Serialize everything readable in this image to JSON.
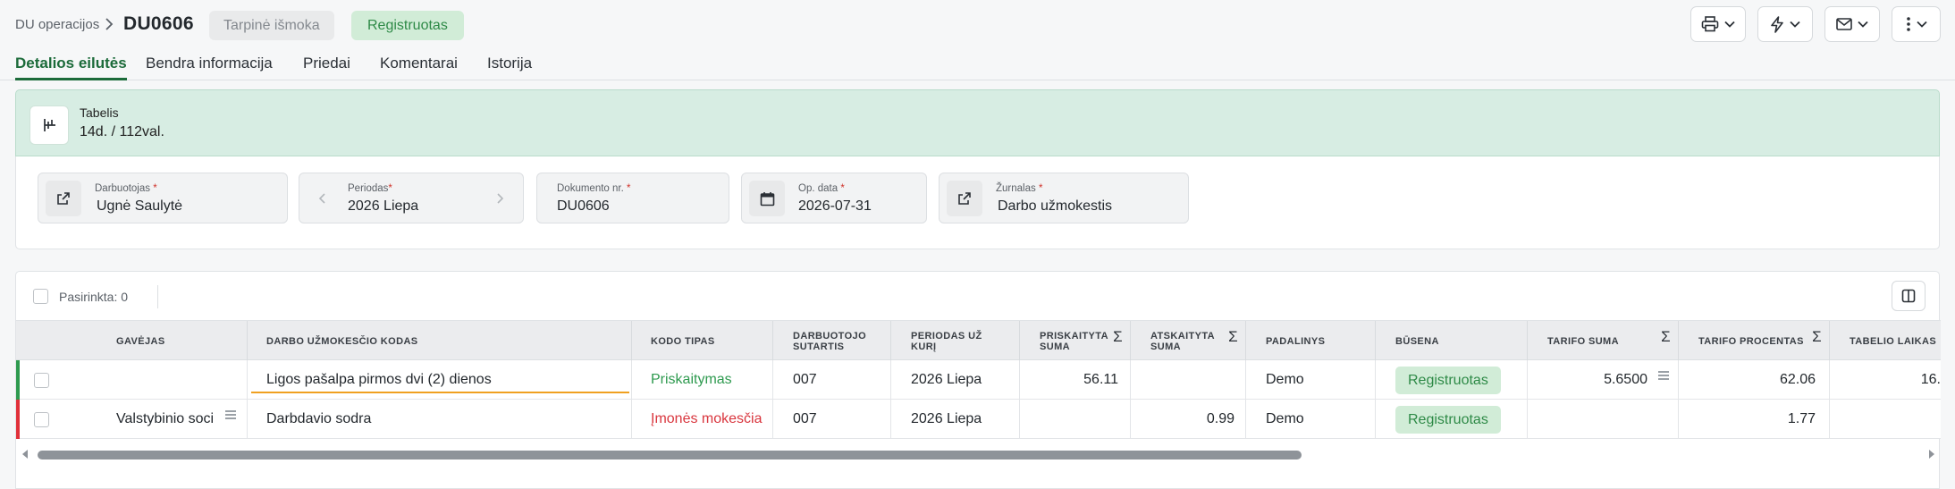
{
  "header": {
    "breadcrumb": "DU operacijos",
    "doc_number": "DU0606",
    "badge_type": "Tarpinė išmoka",
    "badge_status": "Registruotas"
  },
  "toolbar_buttons": [
    {
      "icon": "printer-icon"
    },
    {
      "icon": "lightning-icon"
    },
    {
      "icon": "mail-icon"
    },
    {
      "icon": "more-vertical-icon"
    }
  ],
  "tabs": [
    {
      "label": "Detalios eilutės",
      "active": true
    },
    {
      "label": "Bendra informacija",
      "active": false
    },
    {
      "label": "Priedai",
      "active": false
    },
    {
      "label": "Komentarai",
      "active": false
    },
    {
      "label": "Istorija",
      "active": false
    }
  ],
  "banner": {
    "label": "Tabelis",
    "value": "14d. / 112val."
  },
  "fields": {
    "employee": {
      "label": "Darbuotojas",
      "required": "*",
      "value": "Ugnė Saulytė"
    },
    "period": {
      "label": "Periodas",
      "required": "*",
      "value": "2026 Liepa"
    },
    "doc_nr": {
      "label": "Dokumento nr.",
      "required": "*",
      "value": "DU0606"
    },
    "op_date": {
      "label": "Op. data",
      "required": "*",
      "value": "2026-07-31"
    },
    "journal": {
      "label": "Žurnalas",
      "required": "*",
      "value": "Darbo užmokestis"
    }
  },
  "table": {
    "selected_text": "Pasirinkta: 0",
    "columns": [
      "Gavėjas",
      "Darbo užmokesčio kodas",
      "Kodo tipas",
      "Darbuotojo sutartis",
      "Periodas už kurį",
      "Priskaityta suma",
      "Atskaityta suma",
      "Padalinys",
      "Būsena",
      "Tarifo suma",
      "Tarifo procentas",
      "Tabelio laikas"
    ],
    "sum_symbol": "Σ",
    "rows": [
      {
        "marker": "#2e9a4f",
        "recipient": "",
        "code": "Ligos pašalpa pirmos dvi (2) dienos",
        "code_type": "Priskaitymas",
        "code_type_color": "#2e9a4f",
        "contract": "007",
        "period": "2026 Liepa",
        "accrued": "56.11",
        "deducted": "",
        "unit": "Demo",
        "status": "Registruotas",
        "rate_sum": "5.6500",
        "rate_pct": "62.06",
        "time": "16."
      },
      {
        "marker": "#e0303a",
        "recipient": "Valstybinio soci",
        "code": "Darbdavio sodra",
        "code_type": "Įmonės mokesčia",
        "code_type_color": "#d9363e",
        "contract": "007",
        "period": "2026 Liepa",
        "accrued": "",
        "deducted": "0.99",
        "unit": "Demo",
        "status": "Registruotas",
        "rate_sum": "",
        "rate_pct": "1.77",
        "time": ""
      }
    ]
  }
}
